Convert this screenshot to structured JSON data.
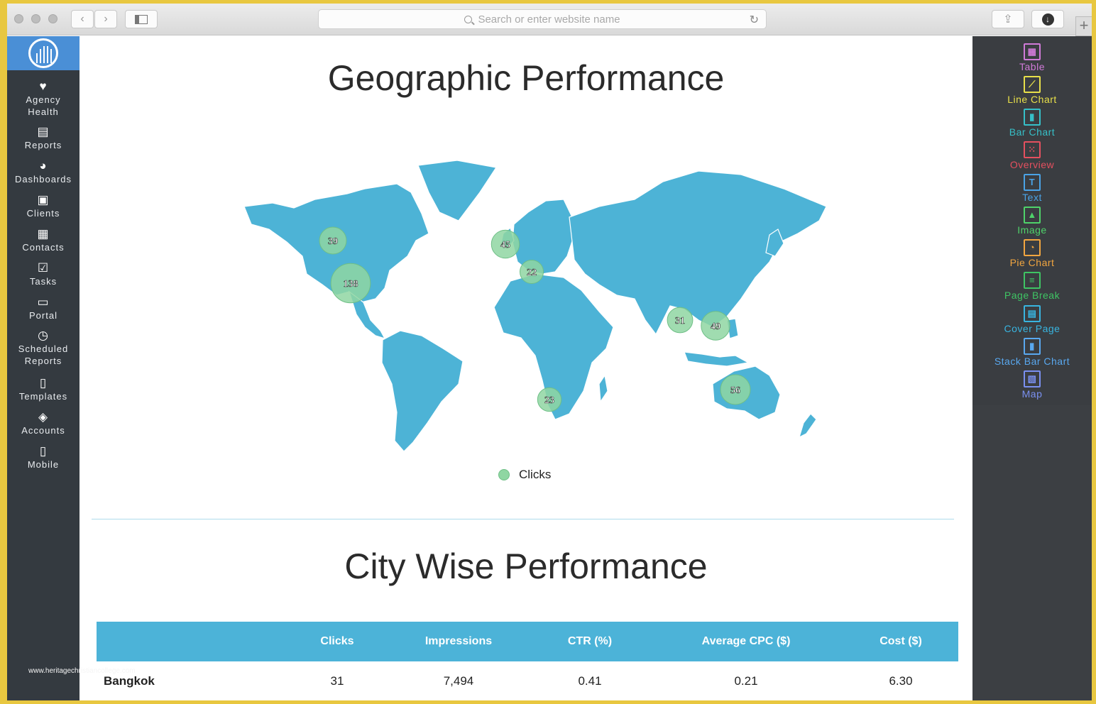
{
  "browser": {
    "address_placeholder": "Search or enter website name"
  },
  "sidebar": {
    "items": [
      {
        "label": "Agency\nHealth",
        "icon": "heart-icon",
        "glyph": "♥"
      },
      {
        "label": "Reports",
        "icon": "report-icon",
        "glyph": "▤"
      },
      {
        "label": "Dashboards",
        "icon": "dashboard-icon",
        "glyph": "◕"
      },
      {
        "label": "Clients",
        "icon": "clients-icon",
        "glyph": "▣"
      },
      {
        "label": "Contacts",
        "icon": "contacts-icon",
        "glyph": "▦"
      },
      {
        "label": "Tasks",
        "icon": "tasks-icon",
        "glyph": "☑"
      },
      {
        "label": "Portal",
        "icon": "portal-icon",
        "glyph": "▭"
      },
      {
        "label": "Scheduled\nReports",
        "icon": "clock-icon",
        "glyph": "◷"
      },
      {
        "label": "Templates",
        "icon": "templates-icon",
        "glyph": "▯"
      },
      {
        "label": "Accounts",
        "icon": "accounts-icon",
        "glyph": "◈"
      },
      {
        "label": "Mobile",
        "icon": "mobile-icon",
        "glyph": "▯"
      }
    ],
    "watermark": "www.heritagechristiancollege.com"
  },
  "main": {
    "title_geo": "Geographic Performance",
    "legend_label": "Clicks",
    "title_city": "City Wise Performance",
    "table": {
      "headers": [
        "",
        "Clicks",
        "Impressions",
        "CTR (%)",
        "Average CPC ($)",
        "Cost ($)"
      ],
      "rows": [
        [
          "Bangkok",
          "31",
          "7,494",
          "0.41",
          "0.21",
          "6.30"
        ]
      ]
    },
    "map_markers": [
      {
        "label": "39",
        "region": "Canada",
        "value": 39
      },
      {
        "label": "138",
        "region": "United States",
        "value": 138
      },
      {
        "label": "45",
        "region": "United Kingdom",
        "value": 45
      },
      {
        "label": "22",
        "region": "Southern Europe",
        "value": 22
      },
      {
        "label": "31",
        "region": "Thailand",
        "value": 31
      },
      {
        "label": "49",
        "region": "Philippines",
        "value": 49
      },
      {
        "label": "23",
        "region": "South Africa",
        "value": 23
      },
      {
        "label": "56",
        "region": "Australia",
        "value": 56
      }
    ],
    "colors": {
      "land": "#4db3d6",
      "marker": "#8fd6a2",
      "header": "#4cb3d8"
    }
  },
  "widgets": [
    {
      "label": "Table",
      "color": "#d07ad8",
      "glyph": "▦"
    },
    {
      "label": "Line Chart",
      "color": "#e8e04a",
      "glyph": "⟋"
    },
    {
      "label": "Bar Chart",
      "color": "#36c0c8",
      "glyph": "▮"
    },
    {
      "label": "Overview",
      "color": "#e5505f",
      "glyph": "⁙"
    },
    {
      "label": "Text",
      "color": "#4aa3e6",
      "glyph": "T"
    },
    {
      "label": "Image",
      "color": "#4fd36a",
      "glyph": "▲"
    },
    {
      "label": "Pie Chart",
      "color": "#f2a640",
      "glyph": "◔"
    },
    {
      "label": "Page Break",
      "color": "#3fc464",
      "glyph": "≡"
    },
    {
      "label": "Cover Page",
      "color": "#38b5e0",
      "glyph": "▤"
    },
    {
      "label": "Stack Bar Chart",
      "color": "#59a8ef",
      "glyph": "▮"
    },
    {
      "label": "Map",
      "color": "#7a90f0",
      "glyph": "▧"
    }
  ]
}
